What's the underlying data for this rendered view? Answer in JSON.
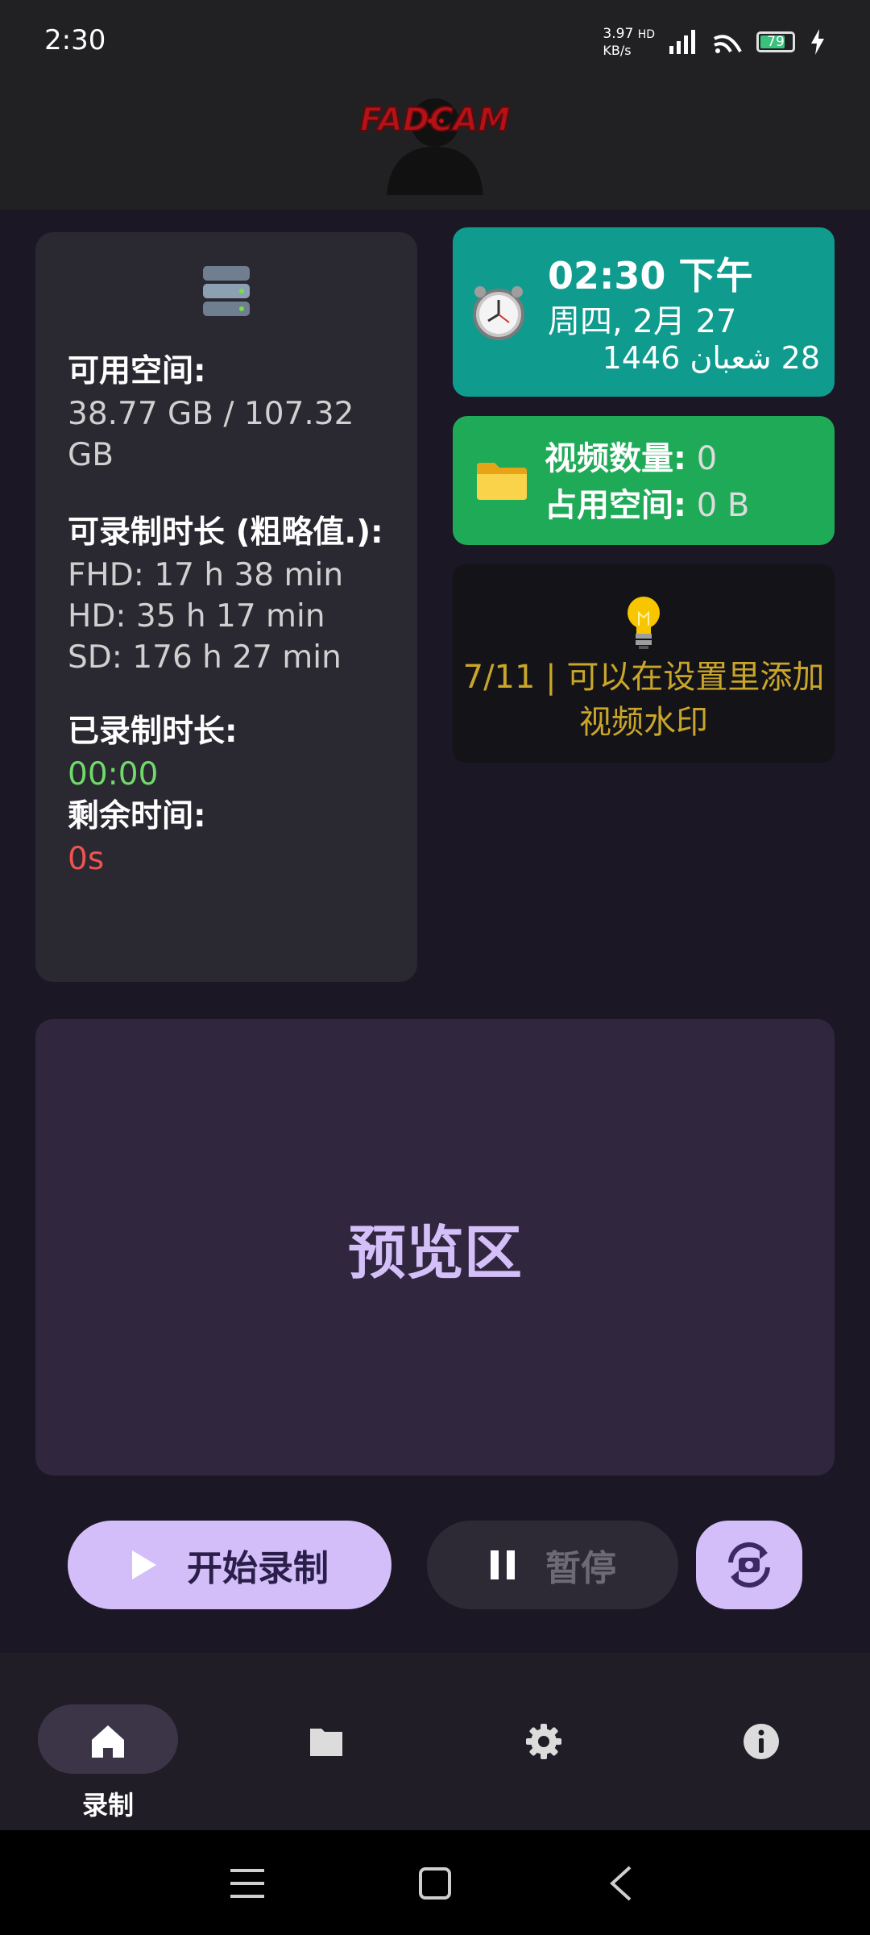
{
  "status_bar": {
    "time": "2:30",
    "net_speed_value": "3.97",
    "net_speed_unit": "KB/s",
    "network_badge": "HD",
    "battery_level": "79",
    "icons": [
      "signal-icon",
      "wifi-icon",
      "battery-icon",
      "charging-icon"
    ]
  },
  "header": {
    "logo_text": "FADCAM"
  },
  "storage": {
    "available_label": "可用空间:",
    "available_value": "38.77 GB / 107.32 GB",
    "record_duration_label": "可录制时长 (粗略值.):",
    "fhd": "FHD: 17 h 38 min",
    "hd": "HD: 35 h 17 min",
    "sd": "SD: 176 h 27 min",
    "recorded_label": "已录制时长:",
    "recorded_value": "00:00",
    "remaining_label": "剩余时间:",
    "remaining_value": "0s"
  },
  "clock": {
    "time": "02:30 下午",
    "date": "周四, 2月 27",
    "hijri": "28 شعبان 1446"
  },
  "videos": {
    "count_label": "视频数量:",
    "count_value": "0",
    "size_label": "占用空间:",
    "size_value": "0 B"
  },
  "tip": {
    "text": "7/11 | 可以在设置里添加视频水印"
  },
  "preview": {
    "title": "预览区"
  },
  "controls": {
    "record_label": "开始录制",
    "pause_label": "暂停"
  },
  "nav": {
    "home_label": "录制"
  },
  "colors": {
    "background": "#1b1725",
    "accent": "#d4bef9",
    "clock_card": "#0f9b8e",
    "video_card": "#1faa58",
    "tip_text": "#c9a62a",
    "recorded": "#6fd96a",
    "remaining": "#ef5350"
  }
}
